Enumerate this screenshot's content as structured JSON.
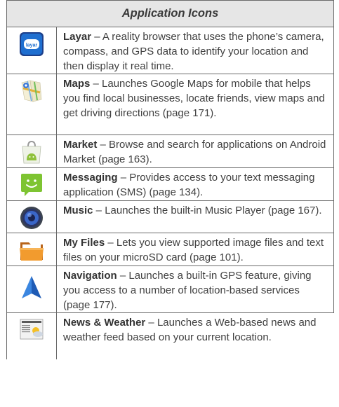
{
  "header": {
    "title": "Application Icons"
  },
  "rows": [
    {
      "icon": "layar-icon",
      "name": "Layar",
      "desc": " –  A reality browser that uses the  phone’s camera, compass, and GPS data to identify your location and then display it real time."
    },
    {
      "icon": "maps-icon",
      "name": "Maps",
      "desc": " – Launches Google Maps for mobile that helps you find local businesses, locate friends, view maps and get driving directions (page 171)."
    },
    {
      "icon": "market-icon",
      "name": "Market",
      "desc": " – Browse and search for applications on Android Market (page 163)."
    },
    {
      "icon": "messaging-icon",
      "name": "Messaging",
      "desc": " – Provides access to your text messaging application (SMS) (page 134)."
    },
    {
      "icon": "music-icon",
      "name": "Music",
      "desc": " – Launches the built-in Music Player (page 167)."
    },
    {
      "icon": "my-files-icon",
      "name": "My Files",
      "desc": " – Lets you view supported image files and text files on your microSD card (page 101)."
    },
    {
      "icon": "navigation-icon",
      "name": "Navigation",
      "desc": " – Launches a built-in GPS feature, giving you access to a number of location-based services (page 177)."
    },
    {
      "icon": "news-weather-icon",
      "name": "News & Weather",
      "desc": " – Launches a Web-based news and weather feed based on your current location."
    }
  ]
}
